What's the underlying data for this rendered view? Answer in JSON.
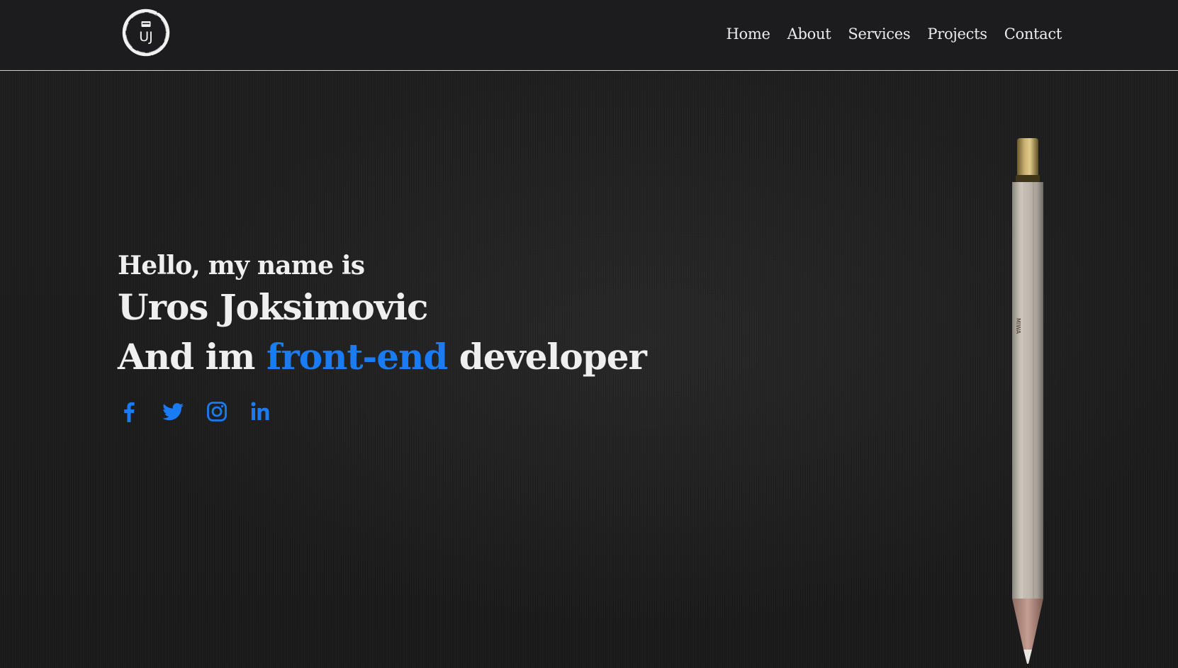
{
  "navbar": {
    "logo_icon": "uj-monogram-logo",
    "logo_text": "UJ",
    "links": [
      {
        "label": "Home"
      },
      {
        "label": "About"
      },
      {
        "label": "Services"
      },
      {
        "label": "Projects"
      },
      {
        "label": "Contact"
      }
    ]
  },
  "hero": {
    "greeting": "Hello, my name is",
    "name": "Uros Joksimovic",
    "role_prefix": "And im",
    "role_highlight": "front-end",
    "role_suffix": "developer",
    "socials": [
      {
        "icon": "facebook-icon"
      },
      {
        "icon": "twitter-icon"
      },
      {
        "icon": "instagram-icon"
      },
      {
        "icon": "linkedin-icon"
      }
    ],
    "pencil_imprint": "MIWA"
  },
  "colors": {
    "navbar_bg": "#1c1c1e",
    "hero_bg": "#1e1e1e",
    "text": "#efefef",
    "accent": "#1a7cf5",
    "divider": "#cfcfcf"
  }
}
